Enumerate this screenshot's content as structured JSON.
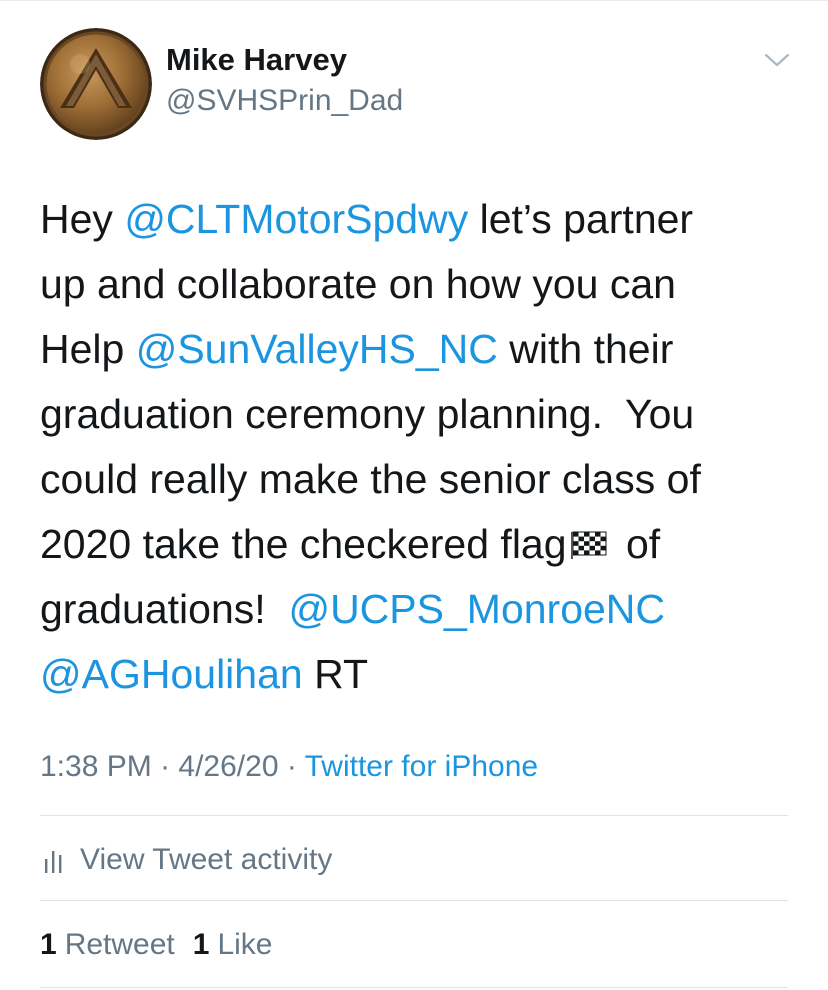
{
  "author": {
    "name": "Mike Harvey",
    "handle": "@SVHSPrin_Dad",
    "avatar": "spartan-shield-avatar"
  },
  "menu": {
    "icon": "chevron-down-icon"
  },
  "tweet": {
    "segments": [
      {
        "text": "Hey ",
        "type": "text"
      },
      {
        "text": "@CLTMotorSpdwy",
        "type": "mention"
      },
      {
        "text": " let’s partner\nup and collaborate on how you can\nHelp ",
        "type": "text"
      },
      {
        "text": "@SunValleyHS_NC",
        "type": "mention"
      },
      {
        "text": " with their\ngraduation ceremony planning.  You\ncould really make the senior class of\n2020 take the checkered flag",
        "type": "text"
      },
      {
        "text": "",
        "type": "emoji",
        "icon": "checkered-flag-icon"
      },
      {
        "text": " of\ngraduations!  ",
        "type": "text"
      },
      {
        "text": "@UCPS_MonroeNC",
        "type": "mention"
      },
      {
        "text": "\n",
        "type": "text"
      },
      {
        "text": "@AGHoulihan",
        "type": "mention"
      },
      {
        "text": " RT",
        "type": "text"
      }
    ]
  },
  "meta": {
    "time": "1:38 PM",
    "sep1": " · ",
    "date": "4/26/20",
    "sep2": " · ",
    "source": "Twitter for iPhone"
  },
  "activity": {
    "label": "View Tweet activity",
    "icon": "bar-chart-icon"
  },
  "stats": {
    "retweets": {
      "count": "1",
      "label": "Retweet"
    },
    "likes": {
      "count": "1",
      "label": "Like"
    }
  },
  "colors": {
    "link": "#1b95e0",
    "secondary": "#657786",
    "primary": "#14171a",
    "divider": "#dfe5ea"
  }
}
